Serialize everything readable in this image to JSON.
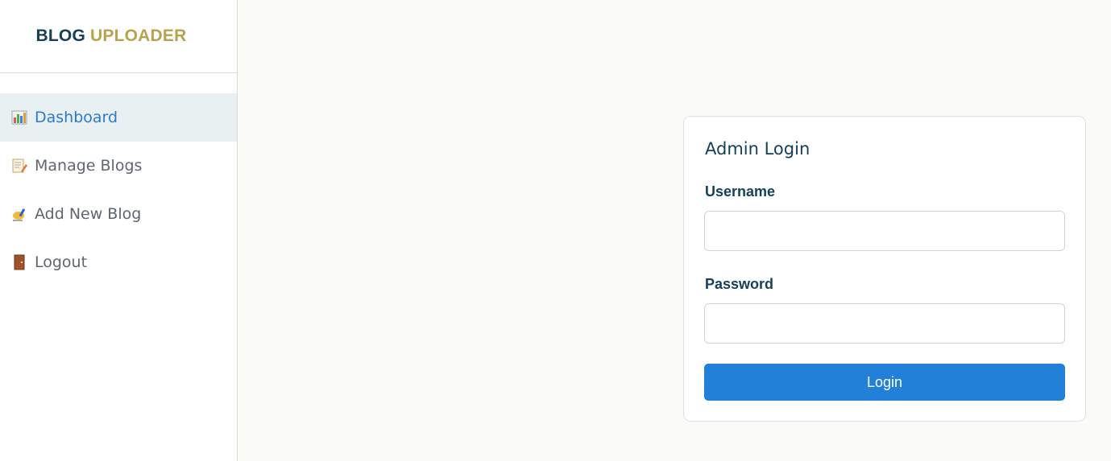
{
  "brand": {
    "part1": "BLOG",
    "part2": "UPLOADER"
  },
  "sidebar": {
    "items": [
      {
        "label": "Dashboard",
        "icon": "bar-chart-icon",
        "active": true
      },
      {
        "label": "Manage Blogs",
        "icon": "memo-icon",
        "active": false
      },
      {
        "label": "Add New Blog",
        "icon": "writing-hand-icon",
        "active": false
      },
      {
        "label": "Logout",
        "icon": "door-icon",
        "active": false
      }
    ]
  },
  "login": {
    "title": "Admin Login",
    "username_label": "Username",
    "username_value": "",
    "password_label": "Password",
    "password_value": "",
    "button_label": "Login"
  },
  "colors": {
    "brand_primary": "#14405a",
    "brand_accent": "#b9a24e",
    "active_link": "#2a7bcf",
    "active_bg": "#e8f0f2",
    "button": "#2380d8"
  }
}
